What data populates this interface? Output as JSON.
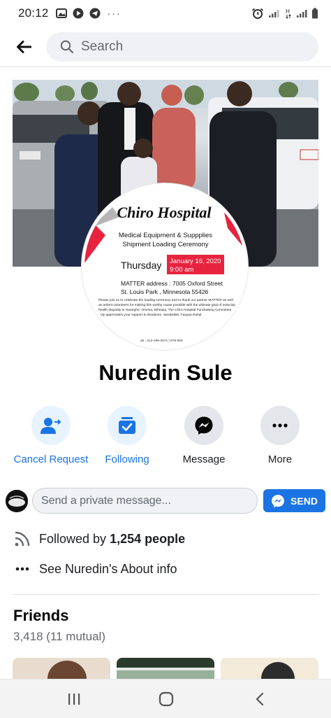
{
  "status_bar": {
    "time": "20:12",
    "overflow": "···"
  },
  "header": {
    "back_icon": "arrow-left-icon",
    "search_placeholder": "Search"
  },
  "cover": {
    "description_icon": "cover-photo"
  },
  "profile_poster": {
    "title": "Chiro Hospital",
    "line1": "Medical Equipment & Suppplies",
    "line2": "Shipment Loading Ceremony",
    "day": "Thursday",
    "date": "January 16, 2020",
    "time": "9:00 am",
    "address1": "MATTER address : 7005 Oxford Street",
    "address2": "St. Louis Park , Minnesota 55426",
    "body": "Please join us to celebrate the loading ceremony and to thank our partner MATTER as well as ardent volunteers for making this worthy cause possible with the ultimate goal of reducing health disparity in Hararghe, Oromia, Ethiopia. The Chiro Hospital Fundraising Committee truly appreciates your support & donations. Jazakallah, Fayyaa Dahal",
    "phones": "ab : 612-286-0671 | 678-908"
  },
  "profile": {
    "name": "Nuredin Sule"
  },
  "actions": [
    {
      "label": "Cancel Request",
      "icon": "person-arrow-icon"
    },
    {
      "label": "Following",
      "icon": "inbox-check-icon"
    },
    {
      "label": "Message",
      "icon": "messenger-icon"
    },
    {
      "label": "More",
      "icon": "more-dots-icon"
    }
  ],
  "message_row": {
    "placeholder": "Send a private message...",
    "send_label": "SEND"
  },
  "info": {
    "followed_prefix": "Followed by ",
    "followed_count": "1,254 people",
    "about": "See Nuredin's About info"
  },
  "friends": {
    "title": "Friends",
    "count": "3,418 (11 mutual)"
  },
  "navbar": {
    "recents_icon": "recent-apps-icon",
    "home_icon": "home-circle-icon",
    "back_icon": "chevron-left-icon"
  },
  "colors": {
    "accent": "#1b74e4",
    "poster_red": "#e8233f"
  }
}
